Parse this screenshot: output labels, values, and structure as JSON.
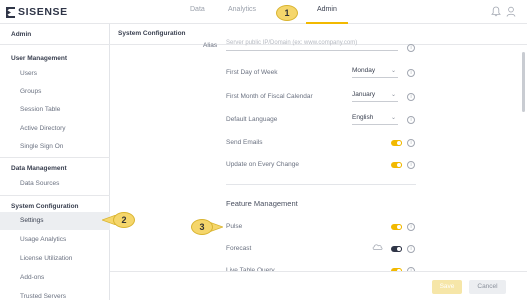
{
  "app": {
    "logo_text": "SISENSE"
  },
  "nav": {
    "items": [
      {
        "label": "Data"
      },
      {
        "label": "Analytics"
      },
      {
        "label": "Admin"
      }
    ],
    "active": "Admin",
    "accent_color": "#f2b900"
  },
  "icons": {
    "notifications": "bell-icon",
    "user": "user-icon"
  },
  "callouts": [
    "1",
    "2",
    "3"
  ],
  "sidebar": {
    "title": "Admin",
    "sections": [
      {
        "title": "User Management",
        "items": [
          "Users",
          "Groups",
          "Session Table",
          "Active Directory",
          "Single Sign On"
        ]
      },
      {
        "title": "Data Management",
        "items": [
          "Data Sources"
        ]
      },
      {
        "title": "System Configuration",
        "items": [
          "Settings",
          "Usage Analytics",
          "License Utilization",
          "Add-ons",
          "Trusted Servers"
        ]
      }
    ],
    "active_item": "Settings"
  },
  "main": {
    "title": "System Configuration",
    "alias": {
      "label": "Alias",
      "placeholder": "Server public IP/Domain (ex: www.company.com)"
    },
    "settings": [
      {
        "label": "First Day of Week",
        "value": "Monday"
      },
      {
        "label": "First Month of Fiscal Calendar",
        "value": "January"
      },
      {
        "label": "Default Language",
        "value": "English"
      },
      {
        "label": "Send Emails",
        "toggle": "on"
      },
      {
        "label": "Update on Every Change",
        "toggle": "on"
      }
    ],
    "feature_management": {
      "title": "Feature Management",
      "features": [
        {
          "label": "Pulse",
          "toggle": "on"
        },
        {
          "label": "Forecast",
          "toggle": "off"
        },
        {
          "label": "Live Table Query",
          "toggle": "on"
        }
      ]
    }
  },
  "footer": {
    "save_label": "Save",
    "cancel_label": "Cancel"
  }
}
